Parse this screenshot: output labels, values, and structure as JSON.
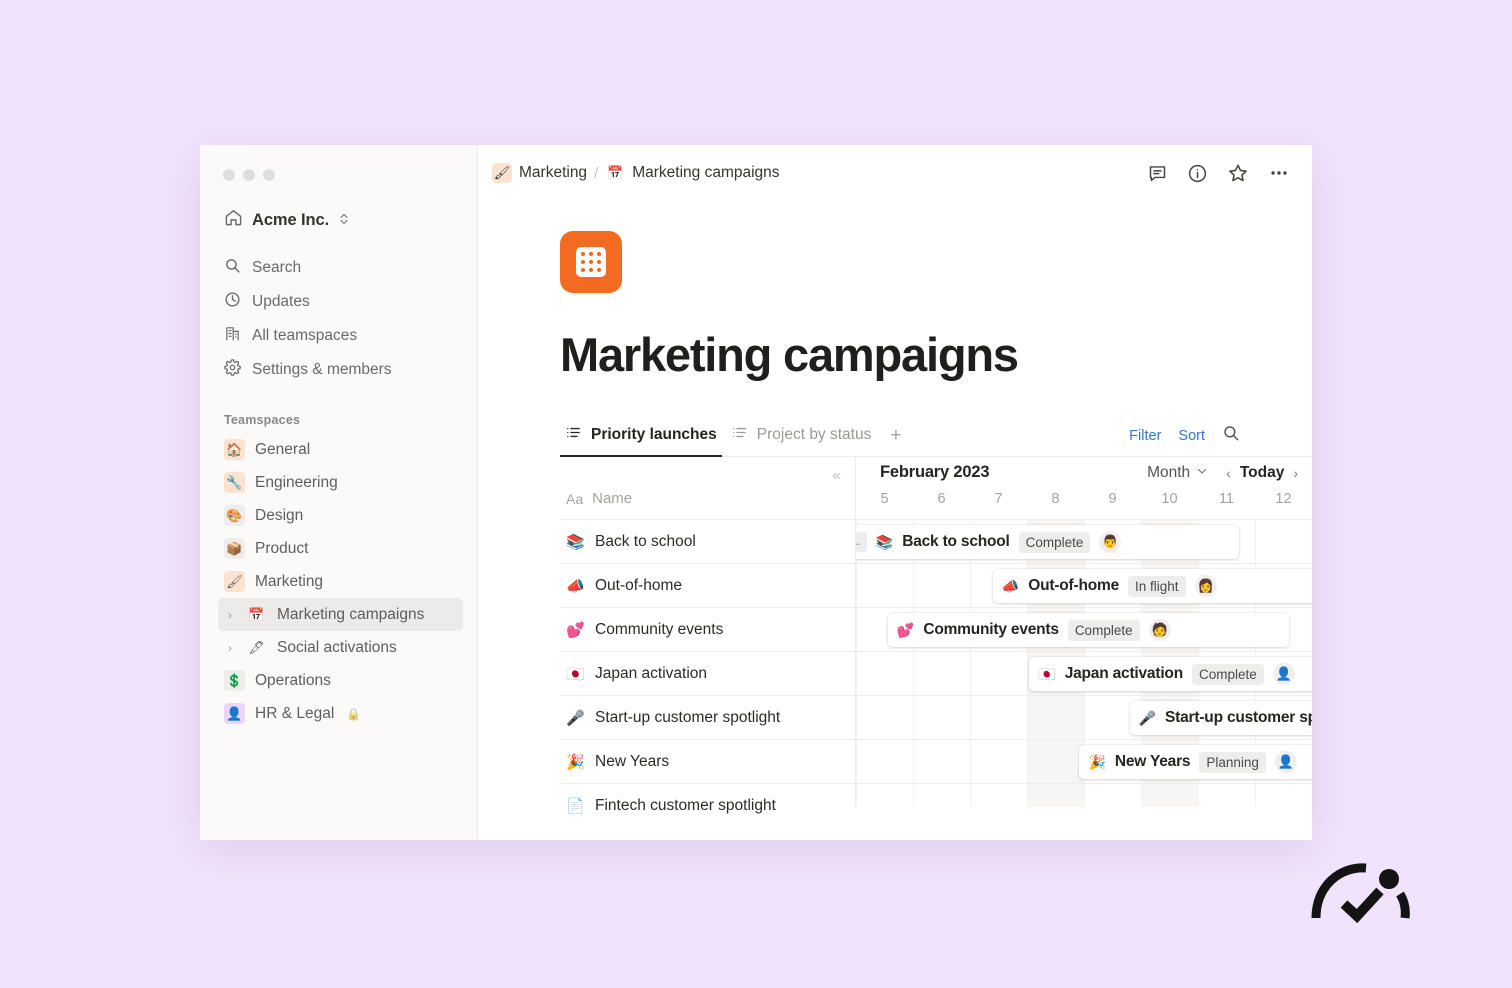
{
  "window": {
    "traffic_lights": [
      "close",
      "minimize",
      "maximize"
    ]
  },
  "sidebar": {
    "workspace": {
      "name": "Acme Inc.",
      "icon": "home-icon",
      "chevron": "⌃⌄"
    },
    "nav": [
      {
        "label": "Search",
        "icon": "search-icon"
      },
      {
        "label": "Updates",
        "icon": "clock-icon"
      },
      {
        "label": "All teamspaces",
        "icon": "building-icon"
      },
      {
        "label": "Settings & members",
        "icon": "gear-icon"
      }
    ],
    "section_label": "Teamspaces",
    "teamspaces": [
      {
        "label": "General",
        "emoji": "🏠",
        "bg": "#fbe3d0",
        "expandable": false,
        "active": false
      },
      {
        "label": "Engineering",
        "emoji": "🔧",
        "bg": "#fbe3d0",
        "expandable": false,
        "active": false
      },
      {
        "label": "Design",
        "emoji": "🎨",
        "bg": "#eeedeb",
        "expandable": false,
        "active": false
      },
      {
        "label": "Product",
        "emoji": "📦",
        "bg": "#eeedeb",
        "expandable": false,
        "active": false
      },
      {
        "label": "Marketing",
        "emoji": "🖌",
        "bg": "#fbe3d0",
        "expandable": false,
        "active": false
      },
      {
        "label": "Marketing campaigns",
        "emoji": "📅",
        "bg": "transparent",
        "expandable": true,
        "active": true
      },
      {
        "label": "Social activations",
        "emoji": "🖋",
        "bg": "transparent",
        "expandable": true,
        "active": false
      },
      {
        "label": "Operations",
        "emoji": "💲",
        "bg": "#eeedeb",
        "expandable": false,
        "active": false
      },
      {
        "label": "HR & Legal",
        "emoji": "👤",
        "bg": "#ead7f7",
        "expandable": false,
        "active": false,
        "locked": true,
        "lock": "🔒"
      }
    ]
  },
  "topbar": {
    "breadcrumb": [
      {
        "label": "Marketing",
        "emoji": "🖌",
        "bg": "#fbe3d0"
      },
      {
        "label": "Marketing campaigns",
        "emoji": "📅",
        "bg": "transparent"
      }
    ],
    "separator": "/",
    "icons": [
      "comment-icon",
      "info-icon",
      "star-icon",
      "more-icon"
    ]
  },
  "page": {
    "icon": "calendar-icon",
    "icon_color": "#f36b21",
    "title": "Marketing campaigns"
  },
  "tabs": [
    {
      "label": "Priority launches",
      "icon": "list-view-icon",
      "active": true
    },
    {
      "label": "Project by status",
      "icon": "list-view-icon",
      "active": false
    }
  ],
  "tab_add": "+",
  "tab_actions": {
    "filter": "Filter",
    "sort": "Sort",
    "search_icon": "search-icon",
    "link_color": "#3478c6"
  },
  "table": {
    "collapse_icon": "«",
    "name_column": {
      "type_icon": "Aa",
      "header": "Name"
    },
    "rows": [
      {
        "name": "Back to school",
        "emoji": "📚"
      },
      {
        "name": "Out-of-home",
        "emoji": "📣"
      },
      {
        "name": "Community events",
        "emoji": "💕"
      },
      {
        "name": "Japan activation",
        "emoji": "🇯🇵"
      },
      {
        "name": "Start-up customer spotlight",
        "emoji": "🎤"
      },
      {
        "name": "New Years",
        "emoji": "🎉"
      },
      {
        "name": "Fintech customer spotlight",
        "emoji": "📄"
      }
    ]
  },
  "timeline": {
    "month": "February 2023",
    "scale": "Month",
    "scale_chevron": "⌄",
    "prev_arrow": "‹",
    "today": "Today",
    "next_arrow": "›",
    "days": [
      "5",
      "6",
      "7",
      "8",
      "9",
      "10",
      "11",
      "12"
    ],
    "weekend_columns": [
      3,
      5
    ],
    "bars": [
      {
        "name": "Back to school",
        "emoji": "📚",
        "status": "Complete",
        "avatar": "👨",
        "has_back_arrow": true,
        "back_arrow": "←",
        "left_pct": -4,
        "width_pct": 88
      },
      {
        "name": "Out-of-home",
        "emoji": "📣",
        "status": "In flight",
        "avatar": "👩",
        "has_back_arrow": false,
        "left_pct": 30,
        "width_pct": 85
      },
      {
        "name": "Community events",
        "emoji": "💕",
        "status": "Complete",
        "avatar": "🧑",
        "has_back_arrow": false,
        "left_pct": 7,
        "width_pct": 88
      },
      {
        "name": "Japan activation",
        "emoji": "🇯🇵",
        "status": "Complete",
        "avatar": "👤",
        "has_back_arrow": false,
        "left_pct": 38,
        "width_pct": 80
      },
      {
        "name": "Start-up customer spotlight",
        "emoji": "🎤",
        "status": "",
        "avatar": "",
        "has_back_arrow": false,
        "left_pct": 60,
        "width_pct": 70
      },
      {
        "name": "New Years",
        "emoji": "🎉",
        "status": "Planning",
        "avatar": "👤",
        "has_back_arrow": false,
        "left_pct": 49,
        "width_pct": 75
      }
    ]
  },
  "logo": {
    "name": "checkmark-arc-logo",
    "color": "#141414"
  }
}
